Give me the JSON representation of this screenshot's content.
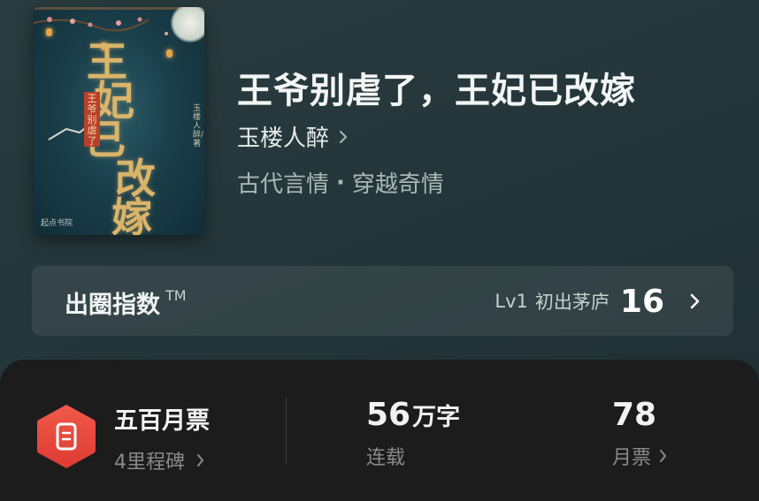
{
  "book": {
    "title": "王爷别虐了，王妃已改嫁",
    "author": "玉楼人醉",
    "tags": [
      "古代言情",
      "穿越奇情"
    ],
    "tag_separator": "·"
  },
  "cover": {
    "title_chars": [
      "王",
      "妃",
      "已",
      "改",
      "嫁"
    ],
    "seal_text": "王爷别虐了",
    "vertical_author": "玉楼人醉/著",
    "brand": "起点书院"
  },
  "index_bar": {
    "label": "出圈指数",
    "trademark": "TM",
    "level": "Lv1",
    "rank_name": "初出茅庐",
    "score": "16"
  },
  "stats": {
    "milestone_title": "五百月票",
    "milestone_sub": "4里程碑",
    "word_count_number": "56",
    "word_count_unit": "万字",
    "status": "连载",
    "monthly_votes": "78",
    "monthly_votes_label": "月票"
  },
  "colors": {
    "ticket_red": "#e8483c",
    "panel_bg": "#1c1c1d",
    "header_bg": "#27393d"
  },
  "icons": {
    "chevron": "chevron-right-icon",
    "ticket": "monthly-ticket-icon"
  }
}
